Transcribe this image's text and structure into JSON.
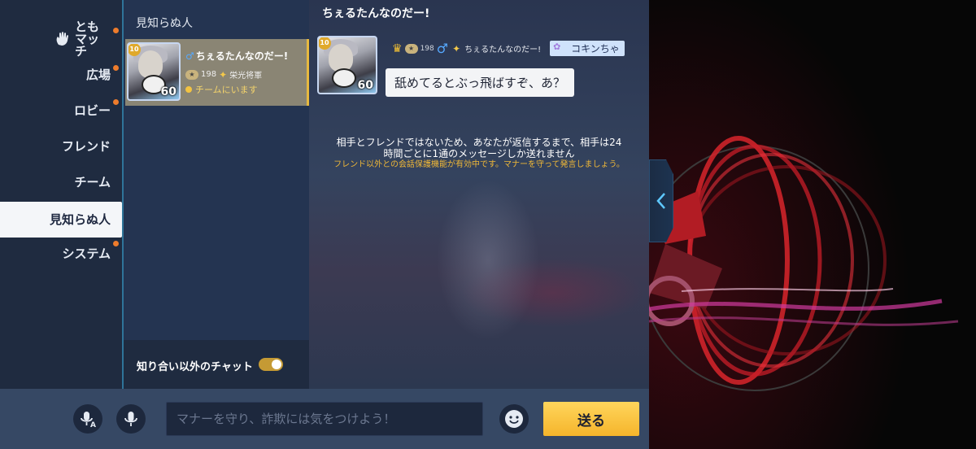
{
  "nav": {
    "items": [
      {
        "label": "とも\nマッチ",
        "has_dot": true
      },
      {
        "label": "広場",
        "has_dot": true
      },
      {
        "label": "ロビー",
        "has_dot": true
      },
      {
        "label": "フレンド",
        "has_dot": false
      },
      {
        "label": "チーム",
        "has_dot": false
      },
      {
        "label": "見知らぬ人",
        "has_dot": false,
        "active": true
      },
      {
        "label": "システム",
        "has_dot": true
      }
    ]
  },
  "conversation_list": {
    "title": "見知らぬ人",
    "item": {
      "name": "ちぇるたんなのだー!",
      "level": "60",
      "badge_number": "198",
      "honor_title": "栄光将軍",
      "status": "チームにいます"
    },
    "toggle_label": "知り合い以外のチャット",
    "toggle_on": true
  },
  "chat": {
    "title": "ちぇるたんなのだー!",
    "message": {
      "sender": "ちぇるたんなのだー!",
      "badge_number": "198",
      "title_tag": "コキンちゃ",
      "level": "60",
      "text": "舐めてるとぶっ飛ばすぞ、あ？"
    },
    "notice_line1": "相手とフレンドではないため、あなたが返信するまで、相手は24",
    "notice_line2": "時間ごとに1通のメッセージしか送れません",
    "warning": "フレンド以外との会話保護機能が有効中です。マナーを守って発言しましょう。"
  },
  "input": {
    "placeholder": "マナーを守り、詐欺には気をつけよう！",
    "value": "",
    "send_label": "送る"
  },
  "colors": {
    "accent": "#f5b52b",
    "notice_warning": "#f0b838",
    "unread_dot": "#ee7c2c"
  }
}
